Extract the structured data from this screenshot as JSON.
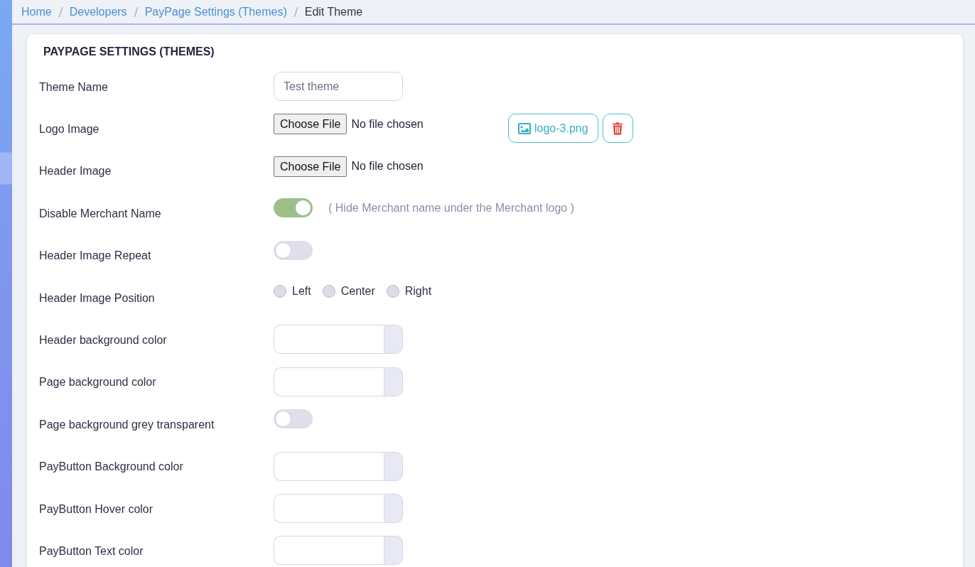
{
  "breadcrumb": [
    {
      "label": "Home",
      "current": false
    },
    {
      "label": "Developers",
      "current": false
    },
    {
      "label": "PayPage Settings (Themes)",
      "current": false
    },
    {
      "label": "Edit Theme",
      "current": true
    }
  ],
  "card": {
    "title": "PAYPAGE SETTINGS (THEMES)"
  },
  "fields": [
    {
      "kind": "text",
      "label": "Theme Name",
      "value": "Test theme"
    },
    {
      "kind": "file",
      "label": "Logo Image",
      "button": "Choose File",
      "status": "No file chosen",
      "attachment": {
        "file_name": "logo-3.png"
      }
    },
    {
      "kind": "file",
      "label": "Header Image",
      "button": "Choose File",
      "status": "No file chosen"
    },
    {
      "kind": "switch",
      "label": "Disable Merchant Name",
      "on": true,
      "hint": "( Hide Merchant name under the Merchant logo )"
    },
    {
      "kind": "switch",
      "label": "Header Image Repeat",
      "on": false
    },
    {
      "kind": "radio",
      "label": "Header Image Position",
      "options": [
        {
          "label": "Left",
          "selected": false
        },
        {
          "label": "Center",
          "selected": false
        },
        {
          "label": "Right",
          "selected": false
        }
      ]
    },
    {
      "kind": "color",
      "label": "Header background color"
    },
    {
      "kind": "color",
      "label": "Page background color"
    },
    {
      "kind": "switch",
      "label": "Page background grey transparent",
      "on": false
    },
    {
      "kind": "color",
      "label": "PayButton Background color"
    },
    {
      "kind": "color",
      "label": "PayButton Hover color"
    },
    {
      "kind": "color",
      "label": "PayButton Text color"
    }
  ]
}
